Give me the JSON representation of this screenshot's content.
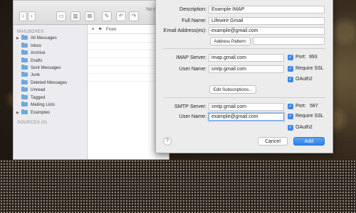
{
  "mail": {
    "title_partial": "No m",
    "sidebar": {
      "mailboxes_heading": "MAILBOXES",
      "sources_heading": "SOURCES (0)",
      "items": [
        {
          "label": "All Messages",
          "expandable": true
        },
        {
          "label": "Inbox",
          "expandable": false
        },
        {
          "label": "Archive",
          "expandable": false
        },
        {
          "label": "Drafts",
          "expandable": false
        },
        {
          "label": "Sent Messages",
          "expandable": false
        },
        {
          "label": "Junk",
          "expandable": false
        },
        {
          "label": "Deleted Messages",
          "expandable": false
        },
        {
          "label": "Unread",
          "expandable": false
        },
        {
          "label": "Tagged",
          "expandable": false
        },
        {
          "label": "Mailing Lists",
          "expandable": false
        },
        {
          "label": "Examples",
          "expandable": true
        }
      ]
    },
    "message_list": {
      "from_header": "From",
      "flag_glyph": "⚑",
      "dot_glyph": "●"
    },
    "toolbar_icons": [
      "close-dot",
      "min-dot",
      "back-icon",
      "forward-icon",
      "archive-icon",
      "trash-icon",
      "compose-icon",
      "reply-icon",
      "forward-mail-icon"
    ]
  },
  "account": {
    "description_label": "Description:",
    "description_value": "Example IMAP",
    "fullname_label": "Full Name:",
    "fullname_value": "Lifewire Gmail",
    "email_label": "Email Address(es):",
    "email_value": "example@gmail.com",
    "address_pattern_label": "Address Pattern:",
    "imap_server_label": "IMAP Server:",
    "imap_server_value": "imap.gmail.com",
    "imap_port_label": "Port:",
    "imap_port_value": "993",
    "imap_username_label": "User Name:",
    "imap_username_value": "smtp.gmail.com",
    "imap_require_ssl_label": "Require SSL",
    "imap_oauth_label": "OAuth2",
    "edit_subscriptions_label": "Edit Subscriptions...",
    "smtp_server_label": "SMTP Server:",
    "smtp_server_value": "smtp.gmail.com",
    "smtp_port_label": "Port:",
    "smtp_port_value": "587",
    "smtp_username_label": "User Name:",
    "smtp_username_value": "example@gmail.com",
    "smtp_require_ssl_label": "Require SSL",
    "smtp_oauth_label": "OAuth2",
    "help_label": "?",
    "cancel_label": "Cancel",
    "add_label": "Add",
    "checkbox_glyph": "✓",
    "accent_color": "#3b86f0"
  }
}
